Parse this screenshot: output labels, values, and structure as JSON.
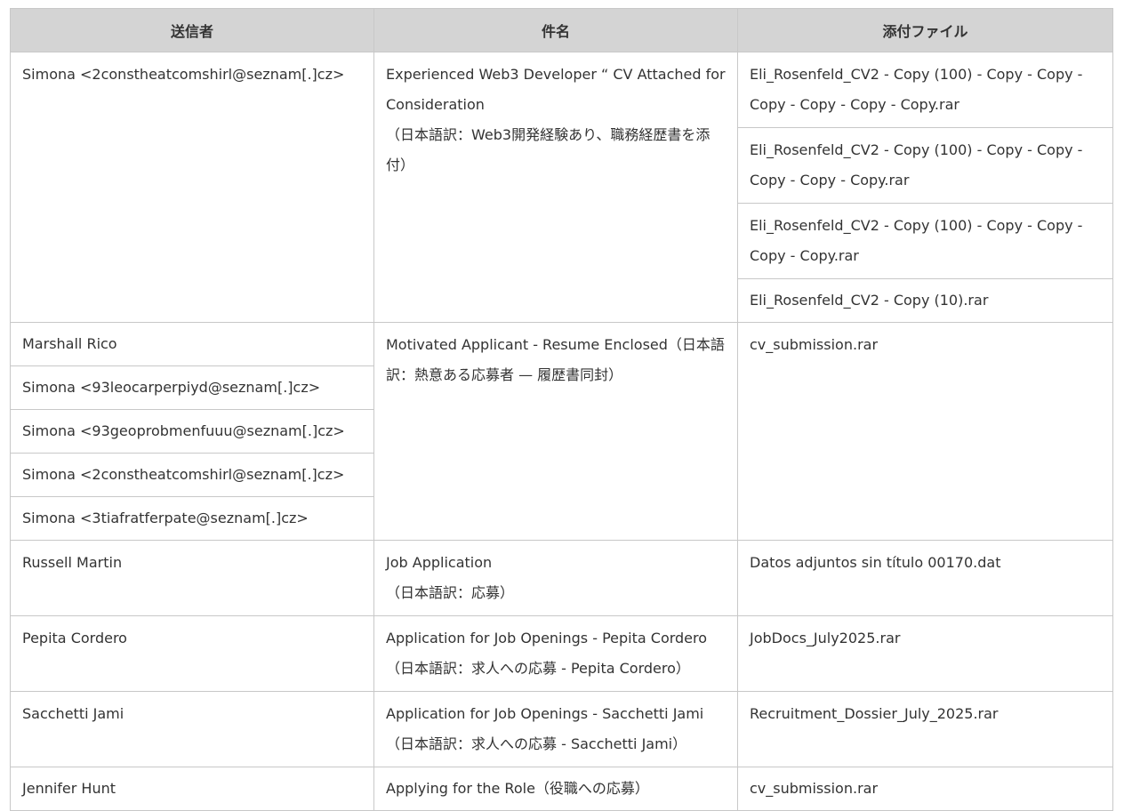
{
  "headers": {
    "sender": "送信者",
    "subject": "件名",
    "attachment": "添付ファイル"
  },
  "groups": [
    {
      "senders": [
        "Simona <2constheatcomshirl@seznam[.]cz>"
      ],
      "subject": [
        "Experienced Web3 Developer “ CV Attached for Consideration",
        "（日本語訳：Web3開発経験あり、職務経歴書を添付）"
      ],
      "attachments": [
        "Eli_Rosenfeld_CV2 - Copy (100) - Copy - Copy - Copy - Copy - Copy - Copy.rar",
        "Eli_Rosenfeld_CV2 - Copy (100) - Copy - Copy - Copy - Copy - Copy.rar",
        "Eli_Rosenfeld_CV2 - Copy (100) - Copy - Copy - Copy - Copy.rar",
        "Eli_Rosenfeld_CV2 - Copy (10).rar"
      ]
    },
    {
      "senders": [
        "Marshall Rico",
        "Simona <93leocarperpiyd@seznam[.]cz>",
        "Simona <93geoprobmenfuuu@seznam[.]cz>",
        "Simona <2constheatcomshirl@seznam[.]cz>",
        "Simona <3tiafratferpate@seznam[.]cz>"
      ],
      "subject": [
        "Motivated Applicant - Resume Enclosed（日本語訳：熱意ある応募者 — 履歴書同封）"
      ],
      "attachments": [
        "cv_submission.rar"
      ]
    },
    {
      "senders": [
        "Russell Martin"
      ],
      "subject": [
        "Job Application",
        "（日本語訳：応募）"
      ],
      "attachments": [
        "Datos adjuntos sin título 00170.dat"
      ]
    },
    {
      "senders": [
        "Pepita Cordero"
      ],
      "subject": [
        "Application for Job Openings - Pepita Cordero",
        "（日本語訳：求人への応募 - Pepita Cordero）"
      ],
      "attachments": [
        "JobDocs_July2025.rar"
      ]
    },
    {
      "senders": [
        "Sacchetti Jami"
      ],
      "subject": [
        "Application for Job Openings - Sacchetti Jami",
        "（日本語訳：求人への応募 - Sacchetti Jami）"
      ],
      "attachments": [
        "Recruitment_Dossier_July_2025.rar"
      ]
    },
    {
      "senders": [
        "Jennifer Hunt"
      ],
      "subject": [
        "Applying for the Role（役職への応募）"
      ],
      "attachments": [
        "cv_submission.rar"
      ]
    }
  ]
}
